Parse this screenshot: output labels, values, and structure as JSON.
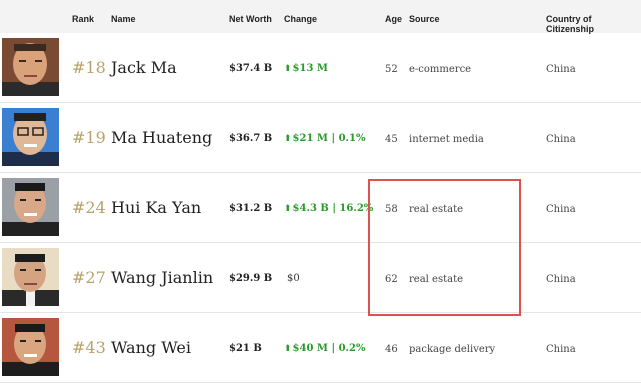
{
  "columns": {
    "rank": "Rank",
    "name": "Name",
    "net_worth": "Net Worth",
    "change": "Change",
    "age": "Age",
    "source": "Source",
    "country": "Country of Citizenship"
  },
  "rows": [
    {
      "rank": "#18",
      "name": "Jack Ma",
      "net_worth": "$37.4 B",
      "change": "$13 M",
      "change_direction": "up",
      "age": "52",
      "source": "e-commerce",
      "country": "China"
    },
    {
      "rank": "#19",
      "name": "Ma Huateng",
      "net_worth": "$36.7 B",
      "change": "$21 M | 0.1%",
      "change_direction": "up",
      "age": "45",
      "source": "internet media",
      "country": "China"
    },
    {
      "rank": "#24",
      "name": "Hui Ka Yan",
      "net_worth": "$31.2 B",
      "change": "$4.3 B | 16.2%",
      "change_direction": "up",
      "age": "58",
      "source": "real estate",
      "country": "China"
    },
    {
      "rank": "#27",
      "name": "Wang Jianlin",
      "net_worth": "$29.9 B",
      "change": "$0",
      "change_direction": "none",
      "age": "62",
      "source": "real estate",
      "country": "China"
    },
    {
      "rank": "#43",
      "name": "Wang Wei",
      "net_worth": "$21 B",
      "change": "$40 M | 0.2%",
      "change_direction": "up",
      "age": "46",
      "source": "package delivery",
      "country": "China"
    }
  ],
  "colors": {
    "rank": "#b8a26a",
    "change_up": "#2a9b2a",
    "highlight_box": "#d9534f"
  }
}
